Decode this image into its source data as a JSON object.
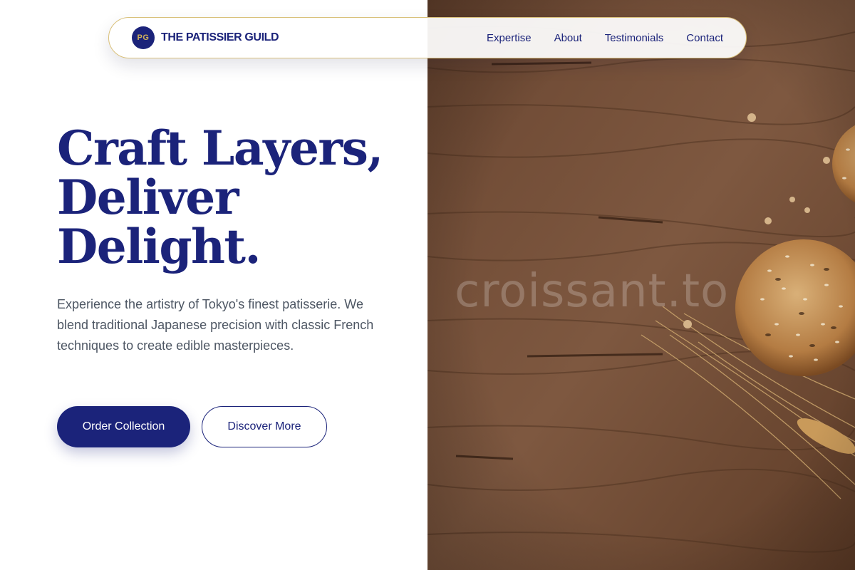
{
  "nav": {
    "logo_initials": "PG",
    "brand": "THE PATISSIER GUILD",
    "links": [
      "Expertise",
      "About",
      "Testimonials",
      "Contact"
    ]
  },
  "hero": {
    "title_lines": [
      "Craft Layers,",
      "Deliver",
      "Delight."
    ],
    "description": "Experience the artistry of Tokyo's finest patisserie. We blend traditional Japanese precision with classic French techniques to create edible masterpieces.",
    "primary_button": "Order Collection",
    "secondary_button": "Discover More"
  },
  "image": {
    "alt": "Rustic wooden table with seeded bread rolls and wheat stalks",
    "watermark": "croissant.to"
  },
  "colors": {
    "brand_navy": "#1b237a",
    "accent_gold": "#d2b25a",
    "body_text": "#4d5663"
  }
}
